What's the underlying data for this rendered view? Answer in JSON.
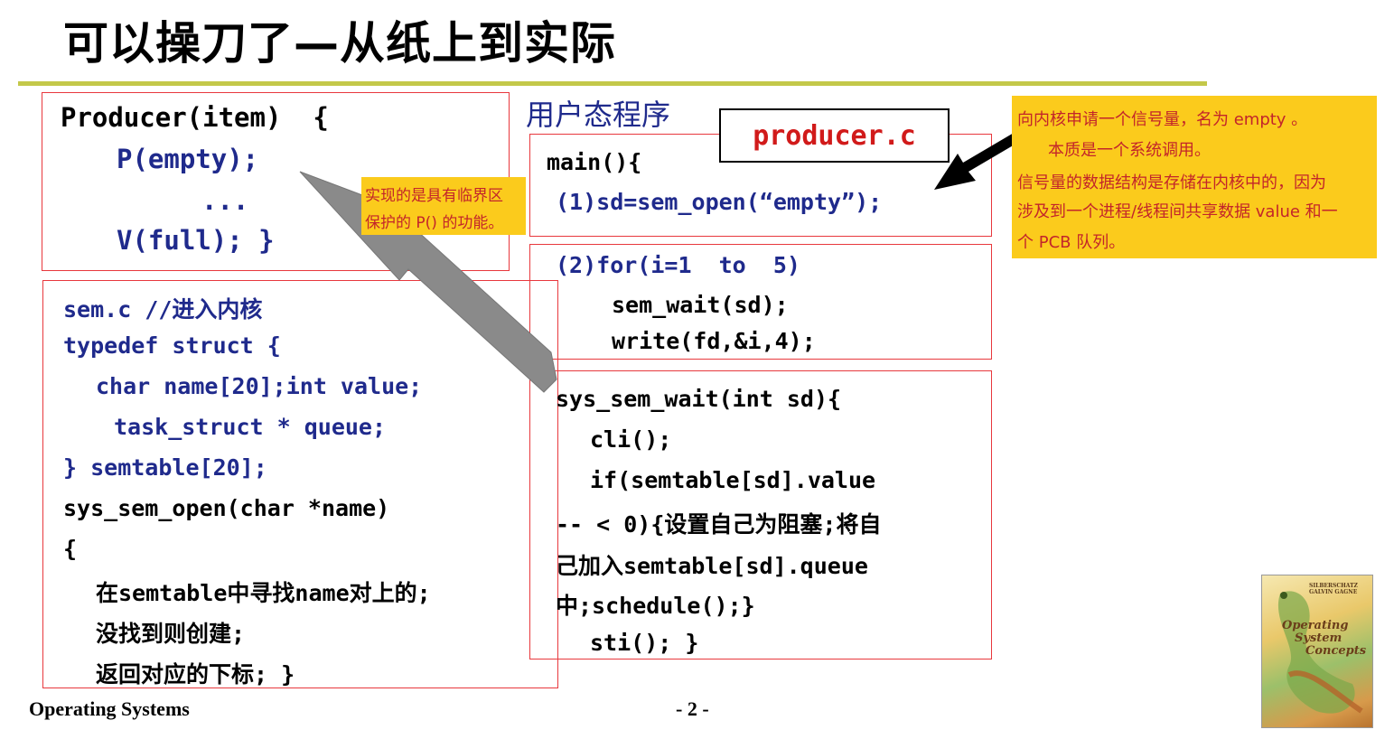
{
  "title": "可以操刀了—从纸上到实际",
  "producer_box": {
    "lines": [
      "Producer(item)  {",
      "P(empty);",
      "...",
      "V(full); }"
    ]
  },
  "user_label": "用户态程序",
  "file_label": "producer.c",
  "main_box": {
    "lines": [
      "main(){",
      "(1)sd=sem_open(“empty”);"
    ]
  },
  "loop_box": {
    "lines": [
      "(2)for(i=1  to  5)",
      "sem_wait(sd);",
      "write(fd,&i,4);"
    ]
  },
  "sem_box": {
    "lines": [
      "sem.c //进入内核",
      "typedef struct {",
      "char name[20];int value;",
      "task_struct * queue;",
      "} semtable[20];",
      "sys_sem_open(char *name)",
      "{",
      "在semtable中寻找name对上的;",
      "没找到则创建;",
      "返回对应的下标; }"
    ]
  },
  "wait_box": {
    "lines": [
      "sys_sem_wait(int sd){",
      "cli();",
      "if(semtable[sd].value",
      "-- < 0){设置自己为阻塞;将自",
      "己加入semtable[sd].queue",
      "中;schedule();}",
      "sti(); }"
    ]
  },
  "note_small": {
    "lines": [
      "实现的是具有临界区",
      "保护的 P() 的功能。"
    ]
  },
  "note_big": {
    "lines": [
      "向内核申请一个信号量，名为 empty 。",
      "本质是一个系统调用。",
      "信号量的数据结构是存储在内核中的，因为",
      "涉及到一个进程/线程间共享数据 value 和一",
      "个 PCB 队列。"
    ]
  },
  "footer": {
    "left": "Operating Systems",
    "page": "- 2 -"
  },
  "book": {
    "authors": "SILBERSCHATZ GALVIN GAGNE",
    "title_line1": "Operating",
    "title_line2": "System",
    "title_line3": "Concepts"
  },
  "colors": {
    "accent_rule": "#c3c84a",
    "box_border": "#e8383d",
    "code_navy": "#1f2a8c",
    "note_bg": "#fbcb1c",
    "note_text": "#c3252a",
    "file_label": "#d11a1a"
  }
}
